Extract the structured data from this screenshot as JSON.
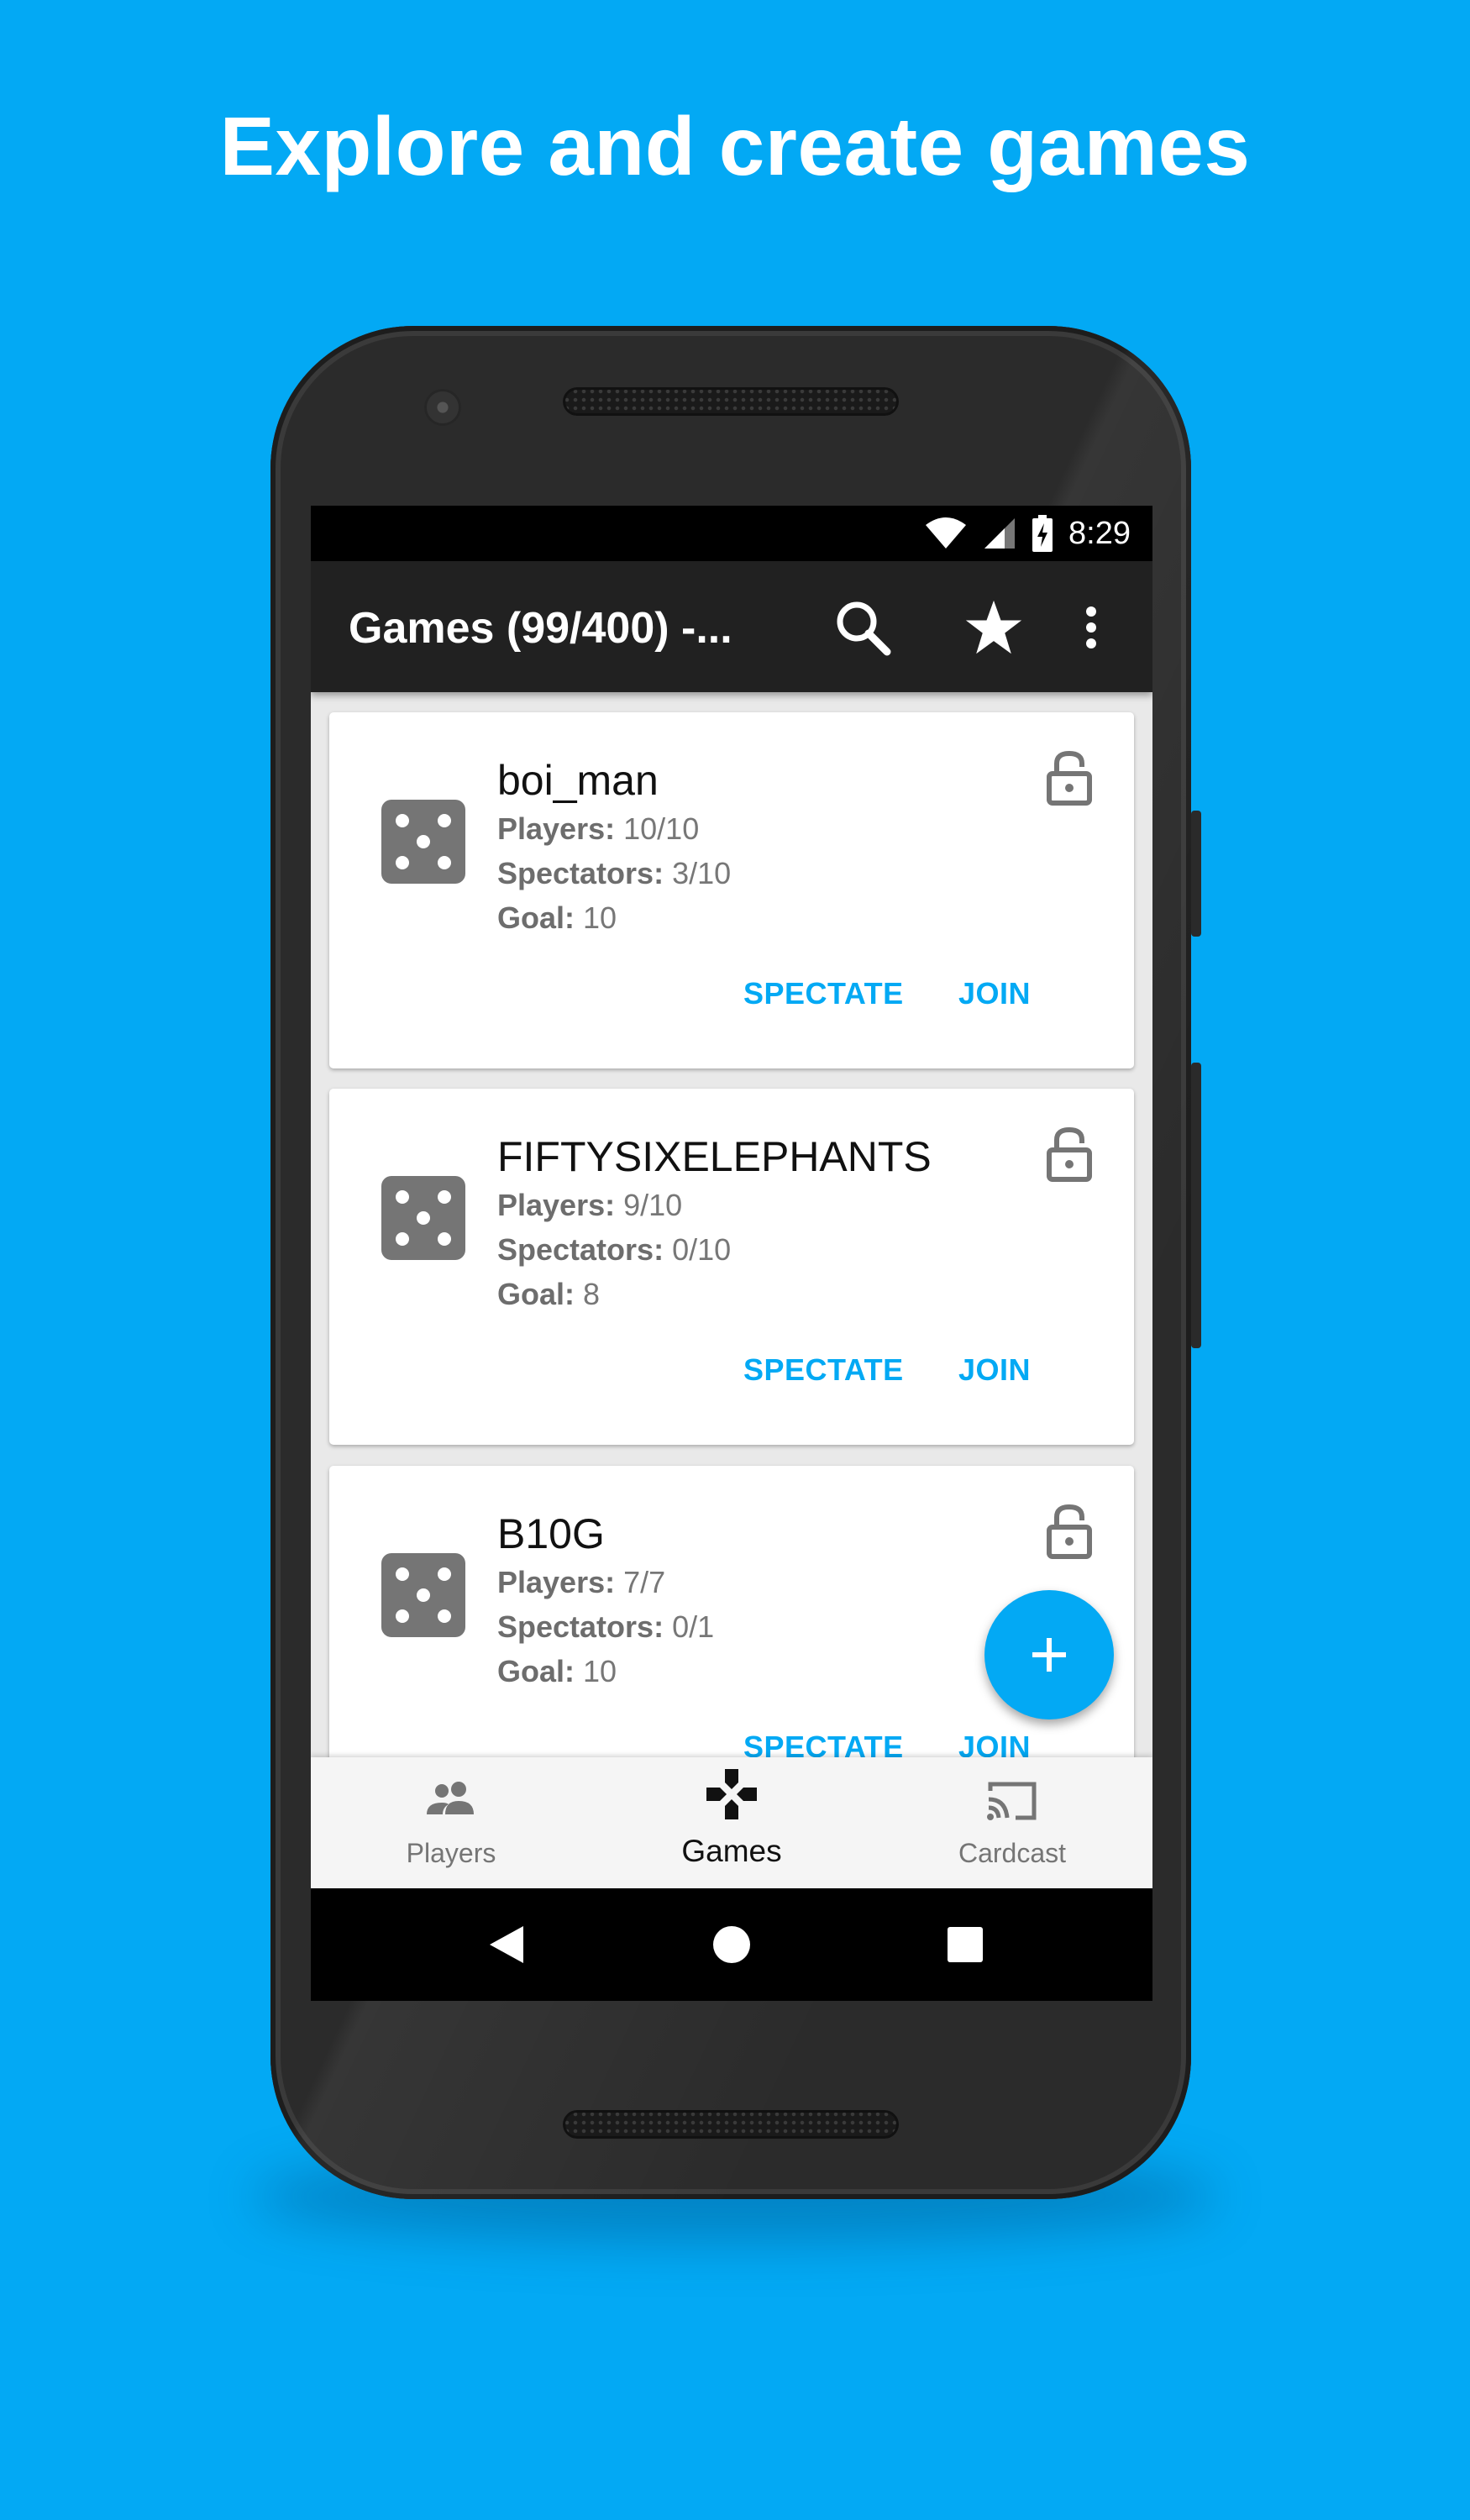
{
  "headline": "Explore and create games",
  "status_bar": {
    "time": "8:29"
  },
  "app_bar": {
    "title": "Games (99/400) -...",
    "actions": [
      "search-icon",
      "star-icon",
      "more-vert-icon"
    ]
  },
  "labels": {
    "players": "Players:",
    "spectators": "Spectators:",
    "goal": "Goal:"
  },
  "games": [
    {
      "name": "boi_man",
      "players": "10/10",
      "spectators": "3/10",
      "goal": "10",
      "spectate_label": "SPECTATE",
      "join_label": "JOIN"
    },
    {
      "name": "FIFTYSIXELEPHANTS",
      "players": "9/10",
      "spectators": "0/10",
      "goal": "8",
      "spectate_label": "SPECTATE",
      "join_label": "JOIN"
    },
    {
      "name": "B10G",
      "players": "7/7",
      "spectators": "0/1",
      "goal": "10",
      "spectate_label": "SPECTATE",
      "join_label": "JOIN"
    }
  ],
  "bottom_nav": {
    "items": [
      {
        "label": "Players",
        "icon": "people-icon",
        "active": false
      },
      {
        "label": "Games",
        "icon": "gamepad-icon",
        "active": true
      },
      {
        "label": "Cardcast",
        "icon": "cast-icon",
        "active": false
      }
    ]
  },
  "colors": {
    "background": "#03a9f4",
    "accent": "#03a9f4",
    "app_bar": "#212121"
  }
}
